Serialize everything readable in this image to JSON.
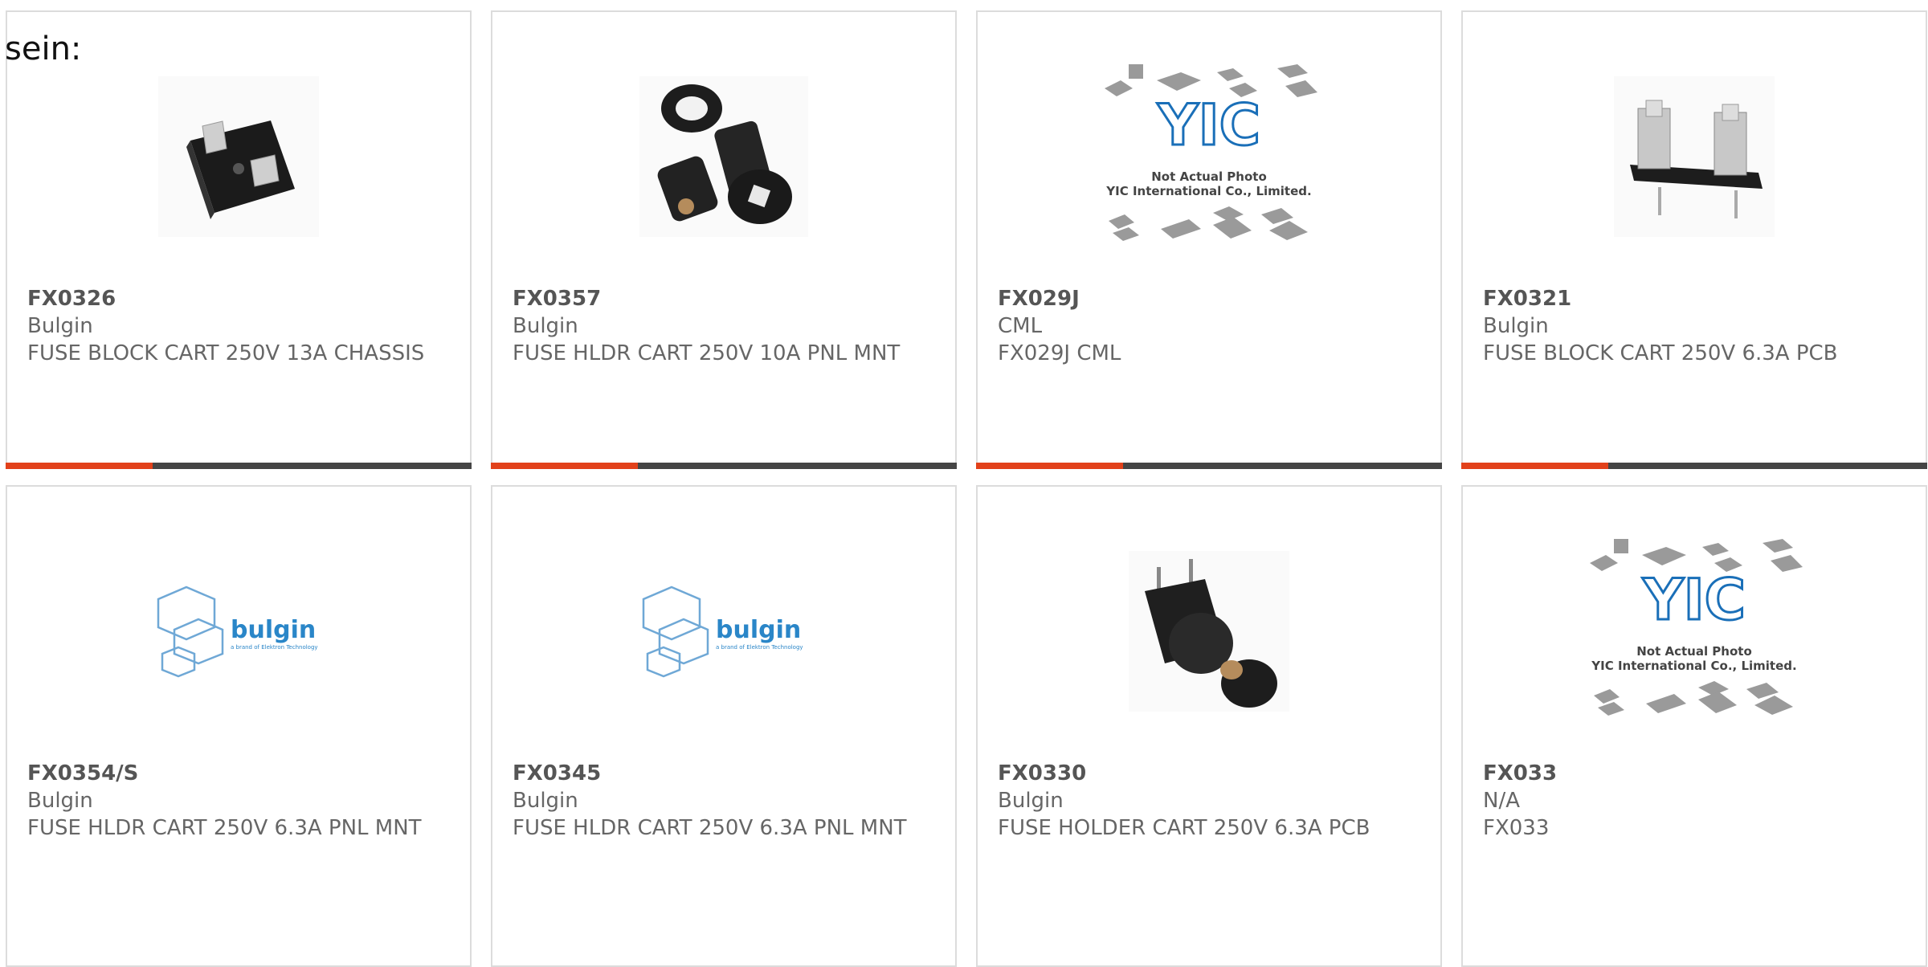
{
  "intro_text": "sein:",
  "products": [
    {
      "part": "FX0326",
      "maker": "Bulgin",
      "desc": "FUSE BLOCK CART 250V 13A CHASSIS",
      "image": "fuse-block-photo"
    },
    {
      "part": "FX0357",
      "maker": "Bulgin",
      "desc": "FUSE HLDR CART 250V 10A PNL MNT",
      "image": "panel-fuse-holder-photo"
    },
    {
      "part": "FX029J",
      "maker": "CML",
      "desc": "FX029J CML",
      "image": "yic-placeholder"
    },
    {
      "part": "FX0321",
      "maker": "Bulgin",
      "desc": "FUSE BLOCK CART 250V 6.3A PCB",
      "image": "pcb-fuse-clip-photo"
    },
    {
      "part": "FX0354/S",
      "maker": "Bulgin",
      "desc": "FUSE HLDR CART 250V 6.3A PNL MNT",
      "image": "bulgin-logo"
    },
    {
      "part": "FX0345",
      "maker": "Bulgin",
      "desc": "FUSE HLDR CART 250V 6.3A PNL MNT",
      "image": "bulgin-logo"
    },
    {
      "part": "FX0330",
      "maker": "Bulgin",
      "desc": "FUSE HOLDER CART 250V 6.3A PCB",
      "image": "pcb-fuse-holder-photo"
    },
    {
      "part": "FX033",
      "maker": "N/A",
      "desc": "FX033",
      "image": "yic-placeholder"
    }
  ],
  "placeholder": {
    "brand": "YIC",
    "line1": "Not Actual Photo",
    "line2": "YIC International Co., Limited."
  },
  "bulgin_logo": {
    "word": "bulgin",
    "tag": "a brand of Elektron Technology"
  },
  "colors": {
    "accent": "#e2411a",
    "bar": "#454545",
    "border": "#dcdcdc",
    "yic_blue": "#1a6fb8",
    "bulgin_blue": "#2a86c8"
  }
}
